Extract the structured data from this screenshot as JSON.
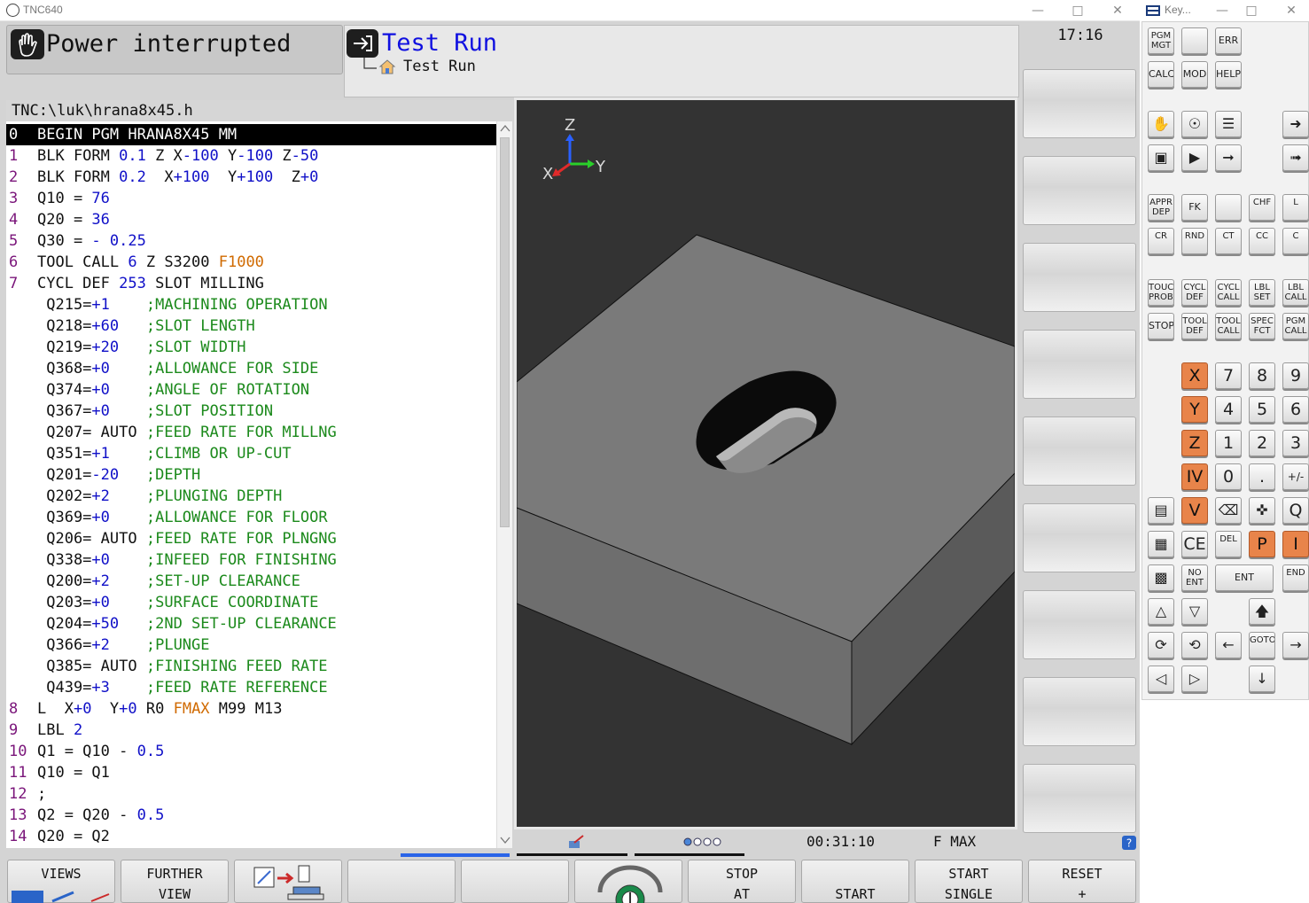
{
  "window": {
    "title": "TNC640"
  },
  "keyboard_window": {
    "title": "Key..."
  },
  "mode": {
    "machine": "Power interrupted",
    "programming": "Test Run",
    "programming_sub": "Test Run"
  },
  "clock": "17:16",
  "file_path": "TNC:\\luk\\hrana8x45.h",
  "program": {
    "lines": [
      {
        "n": "0",
        "parts": [
          [
            "kw",
            "BEGIN PGM HRANA8X45 MM"
          ]
        ]
      },
      {
        "n": "1",
        "parts": [
          [
            "kw",
            "BLK FORM "
          ],
          [
            "num",
            "0.1"
          ],
          [
            "kw",
            " Z X"
          ],
          [
            "num",
            "-100"
          ],
          [
            "kw",
            " Y"
          ],
          [
            "num",
            "-100"
          ],
          [
            "kw",
            " Z"
          ],
          [
            "num",
            "-50"
          ]
        ]
      },
      {
        "n": "2",
        "parts": [
          [
            "kw",
            "BLK FORM "
          ],
          [
            "num",
            "0.2"
          ],
          [
            "kw",
            "  X"
          ],
          [
            "num",
            "+100"
          ],
          [
            "kw",
            "  Y"
          ],
          [
            "num",
            "+100"
          ],
          [
            "kw",
            "  Z"
          ],
          [
            "num",
            "+0"
          ]
        ]
      },
      {
        "n": "3",
        "parts": [
          [
            "kw",
            "Q10 = "
          ],
          [
            "num",
            "76"
          ]
        ]
      },
      {
        "n": "4",
        "parts": [
          [
            "kw",
            "Q20 = "
          ],
          [
            "num",
            "36"
          ]
        ]
      },
      {
        "n": "5",
        "parts": [
          [
            "kw",
            "Q30 = "
          ],
          [
            "num",
            "- 0.25"
          ]
        ]
      },
      {
        "n": "6",
        "parts": [
          [
            "kw",
            "TOOL CALL "
          ],
          [
            "num",
            "6"
          ],
          [
            "kw",
            " Z S3200 "
          ],
          [
            "feed",
            "F1000"
          ]
        ]
      },
      {
        "n": "7",
        "parts": [
          [
            "kw",
            "CYCL DEF "
          ],
          [
            "num",
            "253"
          ],
          [
            "kw",
            " SLOT MILLING"
          ]
        ]
      },
      {
        "n": "",
        "parts": [
          [
            "kw",
            " Q215="
          ],
          [
            "num",
            "+1"
          ],
          [
            "kw",
            "    "
          ],
          [
            "cmt",
            ";MACHINING OPERATION"
          ]
        ]
      },
      {
        "n": "",
        "parts": [
          [
            "kw",
            " Q218="
          ],
          [
            "num",
            "+60"
          ],
          [
            "kw",
            "   "
          ],
          [
            "cmt",
            ";SLOT LENGTH"
          ]
        ]
      },
      {
        "n": "",
        "parts": [
          [
            "kw",
            " Q219="
          ],
          [
            "num",
            "+20"
          ],
          [
            "kw",
            "   "
          ],
          [
            "cmt",
            ";SLOT WIDTH"
          ]
        ]
      },
      {
        "n": "",
        "parts": [
          [
            "kw",
            " Q368="
          ],
          [
            "num",
            "+0"
          ],
          [
            "kw",
            "    "
          ],
          [
            "cmt",
            ";ALLOWANCE FOR SIDE"
          ]
        ]
      },
      {
        "n": "",
        "parts": [
          [
            "kw",
            " Q374="
          ],
          [
            "num",
            "+0"
          ],
          [
            "kw",
            "    "
          ],
          [
            "cmt",
            ";ANGLE OF ROTATION"
          ]
        ]
      },
      {
        "n": "",
        "parts": [
          [
            "kw",
            " Q367="
          ],
          [
            "num",
            "+0"
          ],
          [
            "kw",
            "    "
          ],
          [
            "cmt",
            ";SLOT POSITION"
          ]
        ]
      },
      {
        "n": "",
        "parts": [
          [
            "kw",
            " Q207= AUTO "
          ],
          [
            "cmt",
            ";FEED RATE FOR MILLNG"
          ]
        ]
      },
      {
        "n": "",
        "parts": [
          [
            "kw",
            " Q351="
          ],
          [
            "num",
            "+1"
          ],
          [
            "kw",
            "    "
          ],
          [
            "cmt",
            ";CLIMB OR UP-CUT"
          ]
        ]
      },
      {
        "n": "",
        "parts": [
          [
            "kw",
            " Q201="
          ],
          [
            "num",
            "-20"
          ],
          [
            "kw",
            "   "
          ],
          [
            "cmt",
            ";DEPTH"
          ]
        ]
      },
      {
        "n": "",
        "parts": [
          [
            "kw",
            " Q202="
          ],
          [
            "num",
            "+2"
          ],
          [
            "kw",
            "    "
          ],
          [
            "cmt",
            ";PLUNGING DEPTH"
          ]
        ]
      },
      {
        "n": "",
        "parts": [
          [
            "kw",
            " Q369="
          ],
          [
            "num",
            "+0"
          ],
          [
            "kw",
            "    "
          ],
          [
            "cmt",
            ";ALLOWANCE FOR FLOOR"
          ]
        ]
      },
      {
        "n": "",
        "parts": [
          [
            "kw",
            " Q206= AUTO "
          ],
          [
            "cmt",
            ";FEED RATE FOR PLNGNG"
          ]
        ]
      },
      {
        "n": "",
        "parts": [
          [
            "kw",
            " Q338="
          ],
          [
            "num",
            "+0"
          ],
          [
            "kw",
            "    "
          ],
          [
            "cmt",
            ";INFEED FOR FINISHING"
          ]
        ]
      },
      {
        "n": "",
        "parts": [
          [
            "kw",
            " Q200="
          ],
          [
            "num",
            "+2"
          ],
          [
            "kw",
            "    "
          ],
          [
            "cmt",
            ";SET-UP CLEARANCE"
          ]
        ]
      },
      {
        "n": "",
        "parts": [
          [
            "kw",
            " Q203="
          ],
          [
            "num",
            "+0"
          ],
          [
            "kw",
            "    "
          ],
          [
            "cmt",
            ";SURFACE COORDINATE"
          ]
        ]
      },
      {
        "n": "",
        "parts": [
          [
            "kw",
            " Q204="
          ],
          [
            "num",
            "+50"
          ],
          [
            "kw",
            "   "
          ],
          [
            "cmt",
            ";2ND SET-UP CLEARANCE"
          ]
        ]
      },
      {
        "n": "",
        "parts": [
          [
            "kw",
            " Q366="
          ],
          [
            "num",
            "+2"
          ],
          [
            "kw",
            "    "
          ],
          [
            "cmt",
            ";PLUNGE"
          ]
        ]
      },
      {
        "n": "",
        "parts": [
          [
            "kw",
            " Q385= AUTO "
          ],
          [
            "cmt",
            ";FINISHING FEED RATE"
          ]
        ]
      },
      {
        "n": "",
        "parts": [
          [
            "kw",
            " Q439="
          ],
          [
            "num",
            "+3"
          ],
          [
            "kw",
            "    "
          ],
          [
            "cmt",
            ";FEED RATE REFERENCE"
          ]
        ]
      },
      {
        "n": "8",
        "parts": [
          [
            "kw",
            "L  X"
          ],
          [
            "num",
            "+0"
          ],
          [
            "kw",
            "  Y"
          ],
          [
            "num",
            "+0"
          ],
          [
            "kw",
            " R0 "
          ],
          [
            "feed",
            "FMAX"
          ],
          [
            "kw",
            " M99 M13"
          ]
        ]
      },
      {
        "n": "9",
        "parts": [
          [
            "kw",
            "LBL "
          ],
          [
            "num",
            "2"
          ]
        ]
      },
      {
        "n": "10",
        "parts": [
          [
            "kw",
            "Q1 = Q10 - "
          ],
          [
            "num",
            "0.5"
          ]
        ]
      },
      {
        "n": "11",
        "parts": [
          [
            "kw",
            "Q10 = Q1"
          ]
        ]
      },
      {
        "n": "12",
        "parts": [
          [
            "kw",
            ";"
          ]
        ]
      },
      {
        "n": "13",
        "parts": [
          [
            "kw",
            "Q2 = Q20 - "
          ],
          [
            "num",
            "0.5"
          ]
        ]
      },
      {
        "n": "14",
        "parts": [
          [
            "kw",
            "Q20 = Q2"
          ]
        ]
      }
    ]
  },
  "view3d": {
    "axis_x": "X",
    "axis_y": "Y",
    "axis_z": "Z"
  },
  "status": {
    "time": "00:31:10",
    "feed": "F MAX"
  },
  "softkeys_bottom": [
    {
      "l1": "VIEWS",
      "l2": ""
    },
    {
      "l1": "FURTHER",
      "l2": "VIEW"
    },
    {
      "l1": "",
      "l2": ""
    },
    {
      "l1": "",
      "l2": ""
    },
    {
      "l1": "",
      "l2": ""
    },
    {
      "l1": "",
      "l2": ""
    },
    {
      "l1": "STOP",
      "l2": "AT"
    },
    {
      "l1": "",
      "l2": "START"
    },
    {
      "l1": "START",
      "l2": "SINGLE"
    },
    {
      "l1": "RESET",
      "l2": "+"
    }
  ],
  "keys": {
    "pgm_mgt": "PGM MGT",
    "err": "ERR",
    "calc": "CALC",
    "mod": "MOD",
    "help": "HELP",
    "appr_dep": "APPR DEP",
    "fk": "FK",
    "chf": "CHF",
    "l": "L",
    "cr": "CR",
    "rnd": "RND",
    "ct": "CT",
    "cc": "CC",
    "c": "C",
    "touch_probe": "TOUCH PROBE",
    "cycl_def": "CYCL DEF",
    "cycl_call": "CYCL CALL",
    "lbl_set": "LBL SET",
    "lbl_call": "LBL CALL",
    "stop": "STOP",
    "tool_def": "TOOL DEF",
    "tool_call": "TOOL CALL",
    "spec_fct": "SPEC FCT",
    "pgm_call": "PGM CALL",
    "x": "X",
    "y": "Y",
    "z": "Z",
    "iv": "IV",
    "v": "V",
    "n7": "7",
    "n8": "8",
    "n9": "9",
    "n4": "4",
    "n5": "5",
    "n6": "6",
    "n1": "1",
    "n2": "2",
    "n3": "3",
    "n0": "0",
    "dot": ".",
    "pm": "+/-",
    "q": "Q",
    "ce": "CE",
    "del": "DEL",
    "p": "P",
    "i": "I",
    "no_ent": "NO ENT",
    "ent": "ENT",
    "end": "END",
    "goto": "GOTO"
  }
}
